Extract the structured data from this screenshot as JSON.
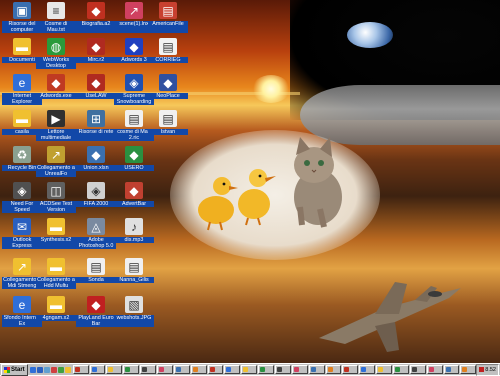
{
  "taskbar": {
    "start_label": "Start",
    "clock": "8.52",
    "quick_launch": [
      "ie-icon",
      "outlook-icon",
      "desktop-icon",
      "channels-icon",
      "media-icon",
      "folder-icon"
    ],
    "task_count": 24
  },
  "desktop_icons": [
    {
      "id": "r0c0",
      "label": "Risorse del computer",
      "icon": "computer-icon",
      "color": "#3a6fb0"
    },
    {
      "id": "r0c1",
      "label": "Cosme di Mau.txt",
      "icon": "text-file-icon",
      "color": "#e8e8e8"
    },
    {
      "id": "r0c2",
      "label": "Biografia.a2",
      "icon": "app-icon",
      "color": "#c03020"
    },
    {
      "id": "r0c3",
      "label": "scene(1).lnx",
      "icon": "shortcut-icon",
      "color": "#d04060"
    },
    {
      "id": "r0c4",
      "label": "AmericanFile",
      "icon": "file-icon",
      "color": "#c84030"
    },
    {
      "id": "r1c0",
      "label": "Documenti",
      "icon": "folder-icon",
      "color": "#f0c030"
    },
    {
      "id": "r1c1",
      "label": "WebWorks Desktop",
      "icon": "globe-icon",
      "color": "#2a9a3a"
    },
    {
      "id": "r1c2",
      "label": "Mirc.r2",
      "icon": "app-icon",
      "color": "#b02a20"
    },
    {
      "id": "r1c3",
      "label": "Adwords 3",
      "icon": "app-icon",
      "color": "#2040c0"
    },
    {
      "id": "r1c4",
      "label": "CORRIEG",
      "icon": "document-icon",
      "color": "#f2f2f2"
    },
    {
      "id": "r2c0",
      "label": "Internet Explorer",
      "icon": "ie-icon",
      "color": "#2f6fd8"
    },
    {
      "id": "r2c1",
      "label": "Adwords.exe",
      "icon": "app-icon",
      "color": "#c03a22"
    },
    {
      "id": "r2c2",
      "label": "UseLAW",
      "icon": "app-icon",
      "color": "#b02a20"
    },
    {
      "id": "r2c3",
      "label": "Supreme Snowboarding",
      "icon": "game-icon",
      "color": "#2050b0"
    },
    {
      "id": "r2c4",
      "label": "NeoPlace",
      "icon": "app-icon",
      "color": "#3050a0"
    },
    {
      "id": "r3c0",
      "label": "casila",
      "icon": "folder-icon",
      "color": "#f0c030"
    },
    {
      "id": "r3c1",
      "label": "Lettore multimediale",
      "icon": "media-player-icon",
      "color": "#303030"
    },
    {
      "id": "r3c2",
      "label": "Risorse di rete",
      "icon": "network-icon",
      "color": "#4070a0"
    },
    {
      "id": "r3c3",
      "label": "cosme di Mau 2.ric",
      "icon": "document-icon",
      "color": "#f0f0f0"
    },
    {
      "id": "r3c4",
      "label": "Istvan",
      "icon": "document-icon",
      "color": "#f0f0f0"
    },
    {
      "id": "r4c0",
      "label": "Recycle Bin",
      "icon": "recycle-bin-icon",
      "color": "#8aa090"
    },
    {
      "id": "r4c1",
      "label": "Collegamento a UnrealFo",
      "icon": "shortcut-icon",
      "color": "#c0a030"
    },
    {
      "id": "r4c2",
      "label": "Union.xlsn",
      "icon": "app-icon",
      "color": "#3a70b0"
    },
    {
      "id": "r4c3",
      "label": "USERO",
      "icon": "app-icon",
      "color": "#2a9040"
    },
    {
      "id": "r5c0",
      "label": "Need For Speed",
      "icon": "game-icon",
      "color": "#505050"
    },
    {
      "id": "r5c1",
      "label": "ACDSee Test Version",
      "icon": "image-viewer-icon",
      "color": "#606060"
    },
    {
      "id": "r5c2",
      "label": "FIFA 2000",
      "icon": "game-icon",
      "color": "#d0d0d0"
    },
    {
      "id": "r5c3",
      "label": "AdvertBar",
      "icon": "app-icon",
      "color": "#c04030"
    },
    {
      "id": "r6c0",
      "label": "Outlook Express",
      "icon": "outlook-icon",
      "color": "#2a60c0"
    },
    {
      "id": "r6c1",
      "label": "Synthesis.x2",
      "icon": "folder-icon",
      "color": "#f0c030"
    },
    {
      "id": "r6c2",
      "label": "Adobe Photoshop 5.0",
      "icon": "photoshop-icon",
      "color": "#7a8aa0"
    },
    {
      "id": "r6c3",
      "label": "dis.mp3",
      "icon": "audio-file-icon",
      "color": "#e0e0e0"
    },
    {
      "id": "r7c0",
      "label": "Collegamento a Mdi Stmeng",
      "icon": "shortcut-icon",
      "color": "#f0c030"
    },
    {
      "id": "r7c1",
      "label": "Collegamento a Hdd Multu",
      "icon": "folder-icon",
      "color": "#f0c030"
    },
    {
      "id": "r7c2",
      "label": "Sonda",
      "icon": "document-icon",
      "color": "#f0f0f0"
    },
    {
      "id": "r7c3",
      "label": "Nanna_Gilis",
      "icon": "document-icon",
      "color": "#f0f0f0"
    },
    {
      "id": "r8c0",
      "label": "Sfondo Internet Ex",
      "icon": "ie-file-icon",
      "color": "#2f6fd8"
    },
    {
      "id": "r8c1",
      "label": "4gngam.x2",
      "icon": "folder-icon",
      "color": "#f0c030"
    },
    {
      "id": "r8c2",
      "label": "PlayLand Euro Bar",
      "icon": "app-icon",
      "color": "#c02020"
    },
    {
      "id": "r8c3",
      "label": "webshots.JPG",
      "icon": "image-file-icon",
      "color": "#e0e0e0"
    }
  ]
}
